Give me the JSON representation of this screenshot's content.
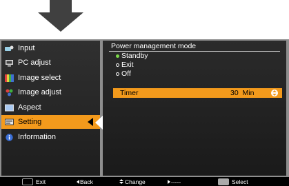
{
  "sidebar": {
    "items": [
      {
        "label": "Input",
        "icon": "input-icon"
      },
      {
        "label": "PC adjust",
        "icon": "pc-adjust-icon"
      },
      {
        "label": "Image select",
        "icon": "image-select-icon"
      },
      {
        "label": "Image adjust",
        "icon": "image-adjust-icon"
      },
      {
        "label": "Aspect",
        "icon": "aspect-icon"
      },
      {
        "label": "Setting",
        "icon": "setting-icon",
        "active": true
      },
      {
        "label": "Information",
        "icon": "information-icon"
      }
    ]
  },
  "panel": {
    "title": "Power management mode",
    "options": [
      {
        "label": "Standby",
        "selected": true
      },
      {
        "label": "Exit",
        "selected": false
      },
      {
        "label": "Off",
        "selected": false
      }
    ],
    "timer": {
      "label": "Timer",
      "value": "30  Min"
    }
  },
  "guide": {
    "exit": "Exit",
    "back": "Back",
    "change": "Change",
    "next": "-----",
    "select": "Select"
  },
  "colors": {
    "highlight": "#f39a1c",
    "selected_dot": "#7cd94a",
    "frame": "#8e8e8e"
  }
}
